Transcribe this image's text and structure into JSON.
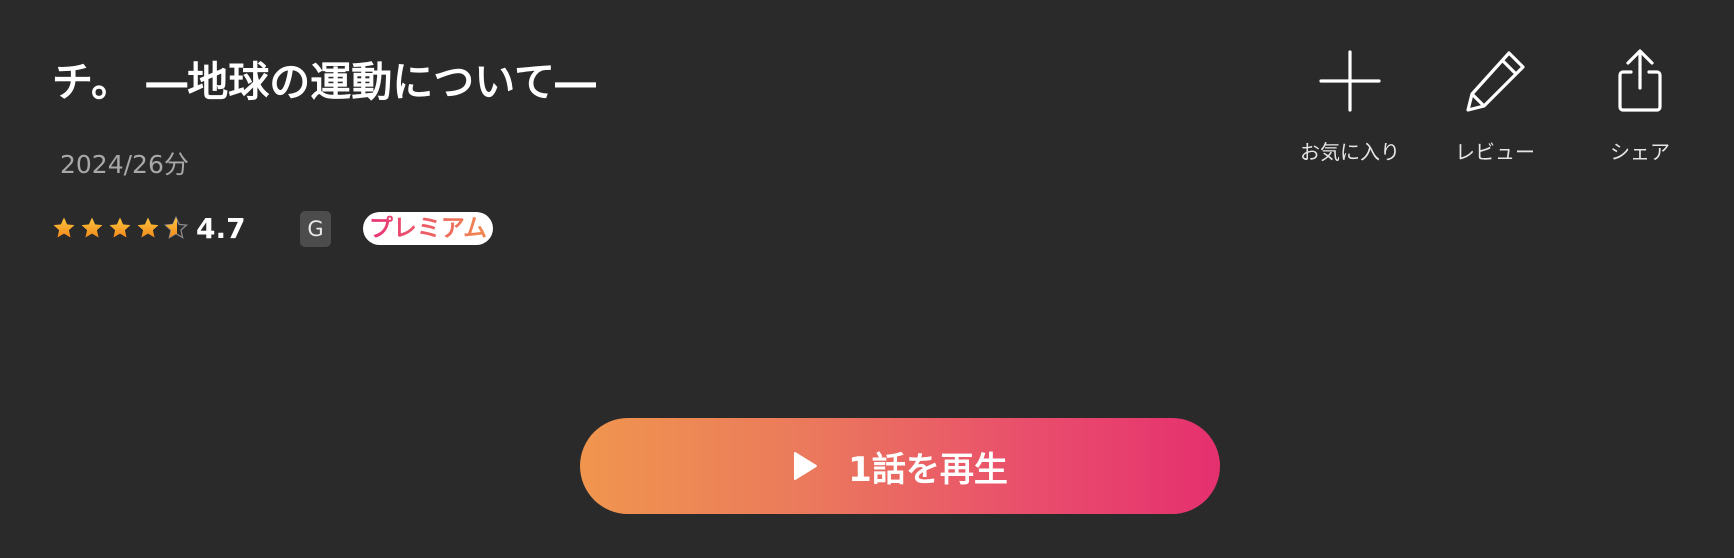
{
  "title": "チ。 ―地球の運動について―",
  "meta": "2024/26分",
  "rating": {
    "value": "4.7",
    "stars": 4.7,
    "max": 5,
    "star_color": "#f5a623"
  },
  "age_rating": "G",
  "premium_label": "プレミアム",
  "actions": {
    "favorite": {
      "label": "お気に入り",
      "icon": "plus-icon"
    },
    "review": {
      "label": "レビュー",
      "icon": "pencil-icon"
    },
    "share": {
      "label": "シェア",
      "icon": "share-icon"
    }
  },
  "play_button": {
    "label": "1話を再生",
    "icon": "play-icon",
    "gradient": [
      "#f0954e",
      "#e5306f"
    ]
  },
  "colors": {
    "background": "#2a2a2a",
    "meta_text": "#a8a8a8"
  }
}
